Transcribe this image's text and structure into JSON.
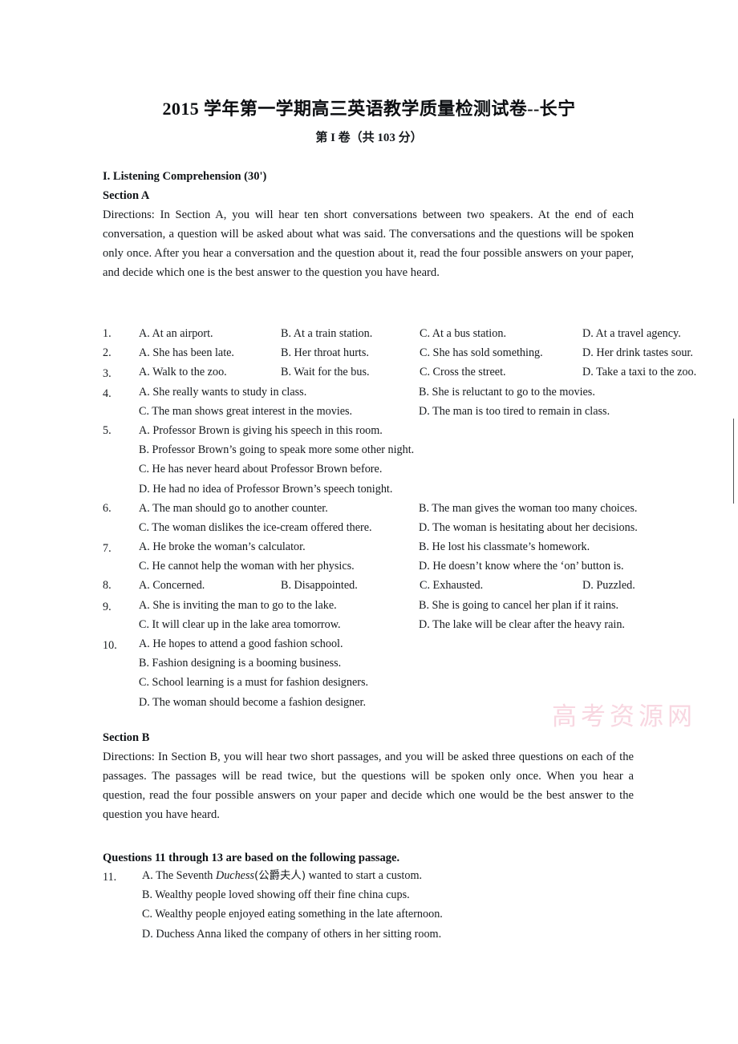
{
  "document": {
    "title": "2015 学年第一学期高三英语教学质量检测试卷--长宁",
    "subtitle": "第 I 卷（共 103 分）",
    "watermark": "高考资源网"
  },
  "part_one": {
    "heading": "I. Listening Comprehension (30')",
    "section_a": {
      "heading": "Section A",
      "directions": "Directions:    In Section A, you will hear ten short conversations between two speakers. At the end of each conversation, a question will be asked about what was said. The conversations and the questions will be spoken only once.    After you hear a conversation and the question about it, read the four possible answers on your paper, and decide which one is the best answer to the question you have heard."
    },
    "section_b": {
      "heading": "Section B",
      "directions": "Directions: In Section B, you will hear two short passages, and you will be asked three questions on each of the passages. The passages will be read twice, but the questions will be spoken only once. When you hear a question, read the four possible answers on your paper and decide which one would be the best answer to the question you have heard.",
      "passage_note": "Questions 11 through 13 are based on the following passage."
    }
  },
  "questions": [
    {
      "number": "1.",
      "layout": "four-column",
      "options": [
        "A. At an airport.",
        "B. At a train station.",
        "C. At a bus station.",
        "D. At a travel agency."
      ]
    },
    {
      "number": "2.",
      "layout": "four-column",
      "options": [
        "A. She has been late.",
        "B. Her throat hurts.",
        "C. She has sold something.",
        "D. Her drink tastes sour."
      ]
    },
    {
      "number": "3.",
      "layout": "four-column",
      "options": [
        "A. Walk to the zoo.",
        "B. Wait for the bus.",
        "C. Cross the street.",
        "D. Take a taxi to the zoo."
      ]
    },
    {
      "number": "4.",
      "layout": "two-column",
      "options": [
        "A. She really wants to study in class.",
        "B. She is reluctant to go to the movies.",
        "C. The man shows great interest in the movies.",
        "D. The man is too tired to remain in class."
      ]
    },
    {
      "number": "5.",
      "layout": "stacked",
      "options": [
        "A. Professor Brown is giving his speech in this room.",
        "B. Professor Brown’s going to speak more some other night.",
        "C. He has never heard about Professor Brown before.",
        "D. He had no idea of Professor Brown’s speech tonight."
      ]
    },
    {
      "number": "6.",
      "layout": "two-column",
      "options": [
        "A. The man should go to another counter.",
        "B. The man gives the woman too many choices.",
        "C. The woman dislikes the ice-cream offered there.",
        "D. The woman is hesitating about her decisions."
      ]
    },
    {
      "number": "7.",
      "layout": "two-column",
      "options": [
        "A. He broke the woman’s calculator.",
        "B. He lost his classmate’s homework.",
        "C. He cannot help the woman with her physics.",
        "D. He doesn’t know where the ‘on’ button is."
      ]
    },
    {
      "number": "8.",
      "layout": "four-column",
      "options": [
        "A. Concerned.",
        "B. Disappointed.",
        "C. Exhausted.",
        "D. Puzzled."
      ]
    },
    {
      "number": "9.",
      "layout": "two-column",
      "options": [
        "A. She is inviting the man to go to the lake.",
        "B. She is going to cancel her plan if it rains.",
        "C. It will clear up in the lake area tomorrow.",
        "D. The lake will be clear after the heavy rain."
      ]
    },
    {
      "number": "10.",
      "layout": "stacked",
      "options": [
        "A. He hopes to attend a good fashion school.",
        "B. Fashion designing is a booming business.",
        "C. School learning is a must for fashion designers.",
        "D. The woman should become a fashion designer."
      ]
    },
    {
      "number": "11.",
      "layout": "stacked",
      "options": [
        "A. The Seventh Duchess(公爵夫人) wanted to start a custom.",
        "B. Wealthy people loved showing off their fine china cups.",
        "C. Wealthy people enjoyed eating something in the late afternoon.",
        "D. Duchess Anna liked the company of others in her sitting room."
      ],
      "option_a_parts": {
        "before": "A. The Seventh ",
        "italic": "Duchess",
        "gloss": "(公爵夫人)",
        "after": " wanted to start a custom."
      }
    }
  ]
}
